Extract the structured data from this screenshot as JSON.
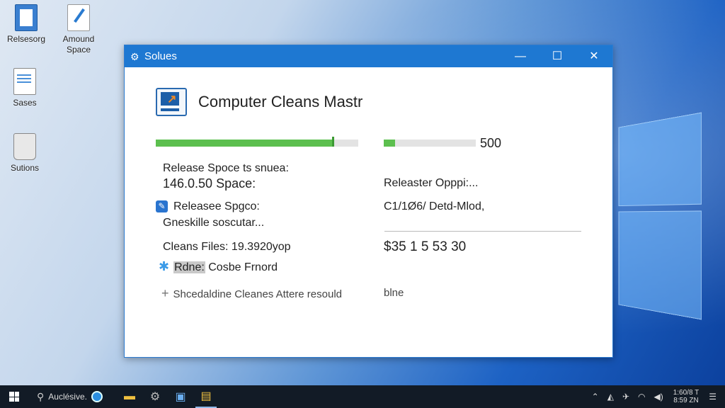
{
  "desktop": {
    "icons": [
      {
        "label": "Relsesorg",
        "icon": "document-icon"
      },
      {
        "label": "Amound Space",
        "icon": "notepad-icon"
      },
      {
        "label": "Sases",
        "icon": "file-icon"
      },
      {
        "label": "Sutions",
        "icon": "recycle-bin-icon"
      }
    ]
  },
  "window": {
    "title": "Solues",
    "controls": {
      "minimize": "—",
      "maximize": "☐",
      "close": "✕"
    },
    "app_name": "Computer Cleans Mastr",
    "progress": {
      "left_fraction": 0.88,
      "right_fraction": 0.12,
      "right_value": "500"
    },
    "left": {
      "release_label": "Release Spoce ts snuea:",
      "space_value": "146.0.50 Space:",
      "releasee_space": "Releasee Spgco:",
      "gneskille": "Gneskille soscutar...",
      "clean_files": "Cleans Files: 19.3920yop",
      "rdne_highlight": "Rdne:",
      "rdne_rest": " Cosbe Frnord",
      "schedule": "Shcedaldine Cleanes Attere resould"
    },
    "right": {
      "releaster": "Releaster Opppi:...",
      "path": "C1/1Ø6/ Detd-Mlod,",
      "amount": "$35 1 5 53 30",
      "blne": "blne"
    }
  },
  "taskbar": {
    "search_label": "Auclésive.",
    "clock_time": "1:60/8 T",
    "clock_date": "8:59 ZN"
  },
  "colors": {
    "accent": "#1e78d2",
    "progress_green": "#5cbf4e",
    "taskbar": "#121b26"
  }
}
